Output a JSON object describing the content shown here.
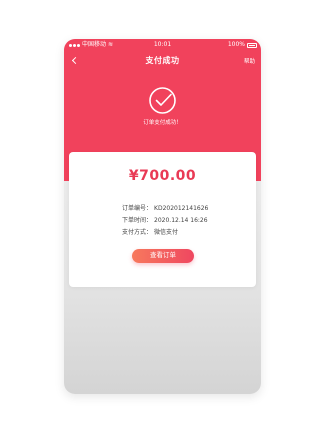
{
  "status_bar": {
    "carrier": "中国移动",
    "time": "10:01",
    "battery": "100%"
  },
  "navbar": {
    "title": "支付成功",
    "help": "帮助"
  },
  "success": {
    "message": "订单支付成功！"
  },
  "order": {
    "amount": "¥700.00",
    "rows": [
      {
        "label": "订单编号：",
        "value": "KD202012141626"
      },
      {
        "label": "下单时间：",
        "value": "2020.12.14 16:26"
      },
      {
        "label": "支付方式：",
        "value": "微信支付"
      }
    ],
    "view_button": "查看订单"
  },
  "colors": {
    "primary": "#f1425c",
    "amount": "#e93a55",
    "button_start": "#f7795d",
    "button_end": "#ef4760"
  }
}
